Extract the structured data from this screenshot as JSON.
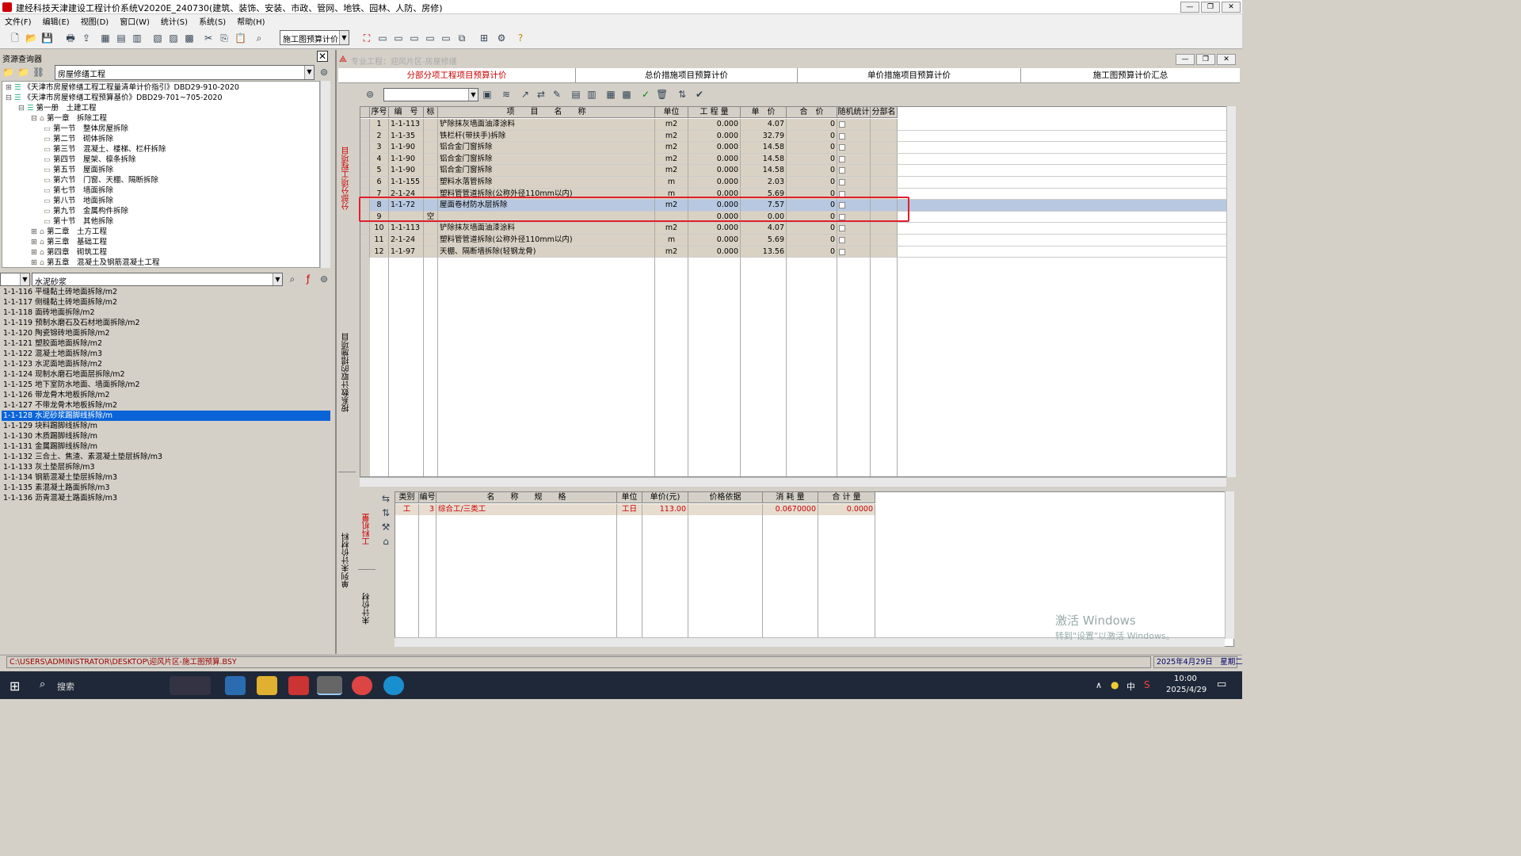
{
  "window": {
    "title": "建经科技天津建设工程计价系统V2020E_240730(建筑、装饰、安装、市政、管网、地铁、园林、人防、房修)",
    "min": "—",
    "max": "❐",
    "close": "✕"
  },
  "menu": [
    "文件(F)",
    "编辑(E)",
    "视图(D)",
    "窗口(W)",
    "统计(S)",
    "系统(S)",
    "帮助(H)"
  ],
  "toolbar": {
    "mode_select": "施工图预算计价"
  },
  "resource": {
    "title": "资源查询器",
    "close": "✕",
    "library": "房屋修缮工程",
    "tree": [
      {
        "label": "《天津市房屋修缮工程工程量清单计价指引》DBD29-910-2020",
        "indent": 0,
        "sign": "⊞"
      },
      {
        "label": "《天津市房屋修缮工程预算基价》DBD29-701~705-2020",
        "indent": 0,
        "sign": "⊟"
      },
      {
        "label": "第一册　土建工程",
        "indent": 1,
        "sign": "⊟"
      },
      {
        "label": "第一章　拆除工程",
        "indent": 2,
        "sign": "⊟"
      },
      {
        "label": "第一节　整体房屋拆除",
        "indent": 3,
        "sign": ""
      },
      {
        "label": "第二节　砌体拆除",
        "indent": 3,
        "sign": ""
      },
      {
        "label": "第三节　混凝土、楼梯、栏杆拆除",
        "indent": 3,
        "sign": ""
      },
      {
        "label": "第四节　屋架、檩条拆除",
        "indent": 3,
        "sign": ""
      },
      {
        "label": "第五节　屋面拆除",
        "indent": 3,
        "sign": ""
      },
      {
        "label": "第六节　门窗、天棚、隔断拆除",
        "indent": 3,
        "sign": ""
      },
      {
        "label": "第七节　墙面拆除",
        "indent": 3,
        "sign": ""
      },
      {
        "label": "第八节　地面拆除",
        "indent": 3,
        "sign": ""
      },
      {
        "label": "第九节　金属构件拆除",
        "indent": 3,
        "sign": ""
      },
      {
        "label": "第十节　其他拆除",
        "indent": 3,
        "sign": ""
      },
      {
        "label": "第二章　土方工程",
        "indent": 2,
        "sign": "⊞"
      },
      {
        "label": "第三章　基础工程",
        "indent": 2,
        "sign": "⊞"
      },
      {
        "label": "第四章　砌筑工程",
        "indent": 2,
        "sign": "⊞"
      },
      {
        "label": "第五章　混凝土及钢筋混凝土工程",
        "indent": 2,
        "sign": "⊞"
      }
    ],
    "search": "水泥砂浆",
    "items": [
      "1-1-116 平缝黏土砖地面拆除/m2",
      "1-1-117 侧缝黏土砖地面拆除/m2",
      "1-1-118 面砖地面拆除/m2",
      "1-1-119 预制水磨石及石材地面拆除/m2",
      "1-1-120 陶瓷锦砖地面拆除/m2",
      "1-1-121 塑胶面地面拆除/m2",
      "1-1-122 混凝土地面拆除/m3",
      "1-1-123 水泥面地面拆除/m2",
      "1-1-124 现制水磨石地面层拆除/m2",
      "1-1-125 地下室防水地面、墙面拆除/m2",
      "1-1-126 带龙骨木地板拆除/m2",
      "1-1-127 不带龙骨木地板拆除/m2",
      "1-1-128 水泥砂浆踢脚线拆除/m",
      "1-1-129 块料踢脚线拆除/m",
      "1-1-130 木质踢脚线拆除/m",
      "1-1-131 金属踢脚线拆除/m",
      "1-1-132 三合土、焦渣、素混凝土垫层拆除/m3",
      "1-1-133 灰土垫层拆除/m3",
      "1-1-134 钢筋混凝土垫层拆除/m3",
      "1-1-135 素混凝土路面拆除/m3",
      "1-1-136 沥青混凝土路面拆除/m3"
    ],
    "selected_index": 12
  },
  "project": {
    "label": "专业工程：迎风片区-房屋修缮"
  },
  "tabs": [
    "分部分项工程项目预算计价",
    "总价措施项目预算计价",
    "单价措施项目预算计价",
    "施工图预算计价汇总"
  ],
  "side_tabs": {
    "top1": "分部分项工程项目",
    "top2": "按系数计取的措施项目",
    "bottom1": "单列未计价材料",
    "bottom_a": "工料机量",
    "bottom_b": "未计价材"
  },
  "grid": {
    "headers": [
      "序号",
      "编　号",
      "标",
      "项　　目　　名　　称",
      "单位",
      "工 程 量",
      "单　价",
      "合　价",
      "随机统计",
      "分部名"
    ],
    "rows": [
      {
        "no": "1",
        "code": "1-1-113",
        "flag": "",
        "name": "铲除抹灰墙面油漆涂料",
        "unit": "m2",
        "qty": "0.000",
        "price": "4.07",
        "total": "0"
      },
      {
        "no": "2",
        "code": "1-1-35",
        "flag": "",
        "name": "铁栏杆(带扶手)拆除",
        "unit": "m2",
        "qty": "0.000",
        "price": "32.79",
        "total": "0"
      },
      {
        "no": "3",
        "code": "1-1-90",
        "flag": "",
        "name": "铝合金门窗拆除",
        "unit": "m2",
        "qty": "0.000",
        "price": "14.58",
        "total": "0"
      },
      {
        "no": "4",
        "code": "1-1-90",
        "flag": "",
        "name": "铝合金门窗拆除",
        "unit": "m2",
        "qty": "0.000",
        "price": "14.58",
        "total": "0"
      },
      {
        "no": "5",
        "code": "1-1-90",
        "flag": "",
        "name": "铝合金门窗拆除",
        "unit": "m2",
        "qty": "0.000",
        "price": "14.58",
        "total": "0"
      },
      {
        "no": "6",
        "code": "1-1-155",
        "flag": "",
        "name": "塑料水落管拆除",
        "unit": "m",
        "qty": "0.000",
        "price": "2.03",
        "total": "0"
      },
      {
        "no": "7",
        "code": "2-1-24",
        "flag": "",
        "name": "塑料管管道拆除(公称外径110mm以内)",
        "unit": "m",
        "qty": "0.000",
        "price": "5.69",
        "total": "0"
      },
      {
        "no": "8",
        "code": "1-1-72",
        "flag": "",
        "name": "屋面卷材防水层拆除",
        "unit": "m2",
        "qty": "0.000",
        "price": "7.57",
        "total": "0"
      },
      {
        "no": "9",
        "code": "",
        "flag": "空",
        "name": "",
        "unit": "",
        "qty": "0.000",
        "price": "0.00",
        "total": "0"
      },
      {
        "no": "10",
        "code": "1-1-113",
        "flag": "",
        "name": "铲除抹灰墙面油漆涂料",
        "unit": "m2",
        "qty": "0.000",
        "price": "4.07",
        "total": "0"
      },
      {
        "no": "11",
        "code": "2-1-24",
        "flag": "",
        "name": "塑料管管道拆除(公称外径110mm以内)",
        "unit": "m",
        "qty": "0.000",
        "price": "5.69",
        "total": "0"
      },
      {
        "no": "12",
        "code": "1-1-97",
        "flag": "",
        "name": "天棚、隔断墙拆除(轻钢龙骨)",
        "unit": "m2",
        "qty": "0.000",
        "price": "13.56",
        "total": "0"
      }
    ],
    "selected_row": 7
  },
  "bottom_grid": {
    "headers": [
      "类别",
      "编号",
      "名　　称　　规　　格",
      "单位",
      "单价(元)",
      "价格依据",
      "消 耗 量",
      "合 计 量"
    ],
    "rows": [
      {
        "type": "工",
        "code": "3",
        "name": "综合工/三类工",
        "unit": "工日",
        "price": "113.00",
        "basis": "",
        "consume": "0.0670000",
        "total": "0.0000"
      }
    ]
  },
  "status": {
    "path": "C:\\USERS\\ADMINISTRATOR\\DESKTOP\\迎风片区-施工图预算.BSY",
    "date": "2025年4月29日　星期二"
  },
  "watermark": {
    "line1": "激活 Windows",
    "line2": "转到\"设置\"以激活 Windows。"
  },
  "taskbar": {
    "search": "搜索",
    "time": "10:00",
    "date": "2025/4/29",
    "ime": "中"
  }
}
